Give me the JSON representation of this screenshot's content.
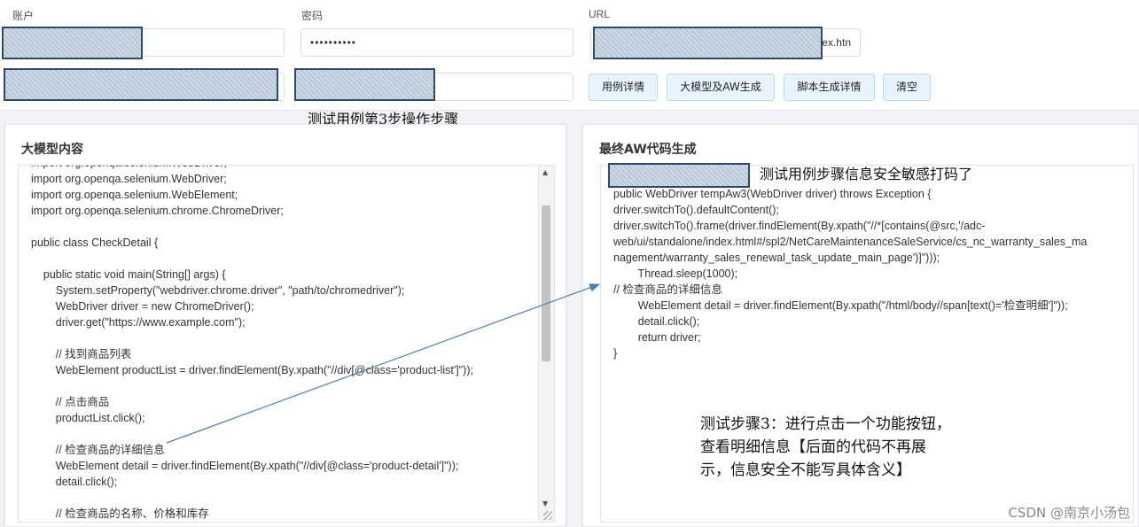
{
  "form": {
    "account_label": "账户",
    "password_label": "密码",
    "url_label": "URL",
    "password_value": "••••••••••",
    "url_value_tail": "ex.htn"
  },
  "buttons": {
    "case_detail": "用例详情",
    "llm_aw": "大模型及AW生成",
    "script_detail": "脚本生成详情",
    "clear": "清空"
  },
  "annotations": {
    "step3_ops": "测试用例第3步操作步骤",
    "masked_info": "测试用例步骤信息安全敏感打码了",
    "step3_desc_1": "测试步骤3：进行点击一个功能按钮，",
    "step3_desc_2": "查看明细信息【后面的代码不再展",
    "step3_desc_3": "示，信息安全不能写具体含义】"
  },
  "left_panel": {
    "title": "大模型内容",
    "code": "import org.openqa.selenium.WebDriver;\nimport org.openqa.selenium.WebDriver;\nimport org.openqa.selenium.WebElement;\nimport org.openqa.selenium.chrome.ChromeDriver;\n\npublic class CheckDetail {\n\n    public static void main(String[] args) {\n        System.setProperty(\"webdriver.chrome.driver\", \"path/to/chromedriver\");\n        WebDriver driver = new ChromeDriver();\n        driver.get(\"https://www.example.com\");\n\n        // 找到商品列表\n        WebElement productList = driver.findElement(By.xpath(\"//div[@class='product-list']\"));\n\n        // 点击商品\n        productList.click();\n\n        // 检查商品的详细信息\n        WebElement detail = driver.findElement(By.xpath(\"//div[@class='product-detail']\"));\n        detail.click();\n\n        // 检查商品的名称、价格和库存"
  },
  "right_panel": {
    "title": "最终AW代码生成",
    "code": "public WebDriver tempAw3(WebDriver driver) throws Exception {\ndriver.switchTo().defaultContent();\ndriver.switchTo().frame(driver.findElement(By.xpath(\"//*[contains(@src,'/adc-\nweb/ui/standalone/index.html#/spl2/NetCareMaintenanceSaleService/cs_nc_warranty_sales_ma\nnagement/warranty_sales_renewal_task_update_main_page')]\")));\n        Thread.sleep(1000);\n// 检查商品的详细信息\n        WebElement detail = driver.findElement(By.xpath(\"/html/body//span[text()='检查明细']\"));\n        detail.click();\n        return driver;\n}"
  },
  "watermark": "CSDN @南京小汤包",
  "colors": {
    "button_bg": "#e8f4fd",
    "redaction": "#b6c7d7",
    "arrow": "#4a7fb5"
  }
}
